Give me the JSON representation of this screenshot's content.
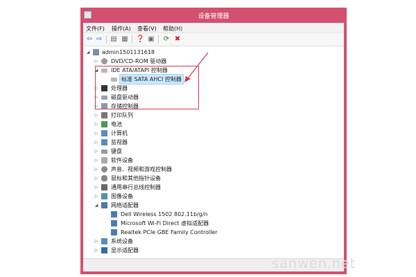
{
  "window": {
    "title": "设备管理器"
  },
  "menu": {
    "file": "文件(F)",
    "action": "操作(A)",
    "view": "查看(V)",
    "help": "帮助(H)"
  },
  "tree": {
    "root": "admin1501131618",
    "dvd": "DVD/CD-ROM 驱动器",
    "ide": "IDE ATA/ATAPI 控制器",
    "sata": "标准 SATA AHCI 控制器",
    "cpu": "处理器",
    "disk": "磁盘驱动器",
    "storage": "存储控制器",
    "printq": "打印队列",
    "battery": "电池",
    "computer": "计算机",
    "monitor": "监视器",
    "keyboard": "键盘",
    "software": "软件设备",
    "sound": "声音、视频和游戏控制器",
    "mouse": "鼠标和其他指针设备",
    "usb": "通用串行总线控制器",
    "imaging": "图像设备",
    "network": "网络适配器",
    "net1": "Dell Wireless 1502 802.11b/g/n",
    "net2": "Microsoft Wi-Fi Direct 虚拟适配器",
    "net3": "Realtek PCIe GBE Family Controller",
    "system": "系统设备",
    "display": "显示适配器"
  },
  "watermark": "sanwen.net",
  "colors": {
    "titlebar": "#d3506f",
    "annotation": "#d03a55",
    "selection": "#cce8ff"
  }
}
